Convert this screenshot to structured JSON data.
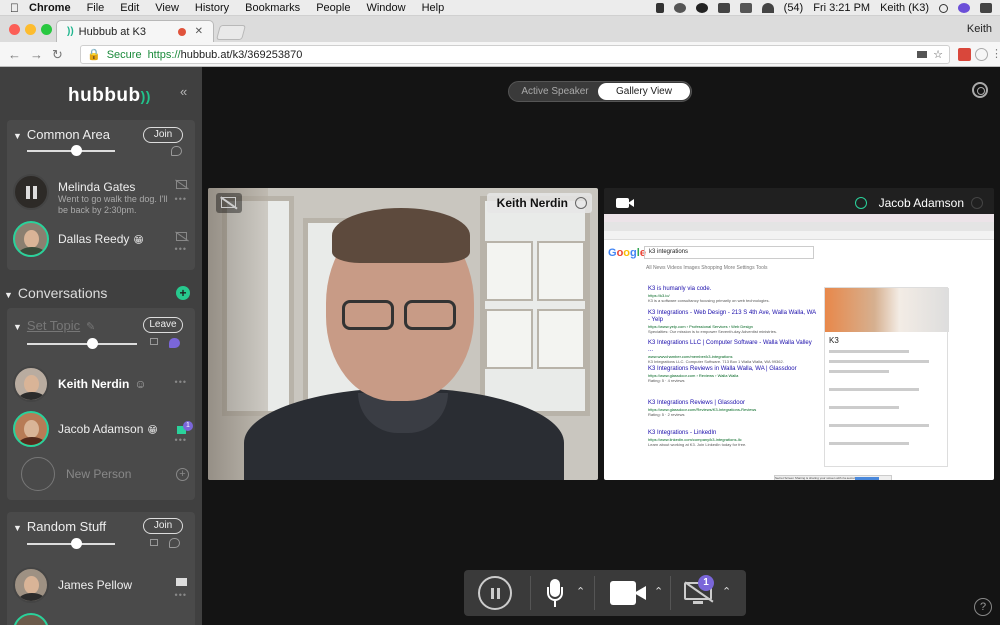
{
  "menubar": {
    "app": "Chrome",
    "items": [
      "File",
      "Edit",
      "View",
      "History",
      "Bookmarks",
      "People",
      "Window",
      "Help"
    ],
    "battery": "(54)",
    "clock": "Fri 3:21 PM",
    "user": "Keith (K3)"
  },
  "browser": {
    "tab_title": "Hubbub at K3",
    "profile_name": "Keith",
    "secure_label": "Secure",
    "url_scheme": "https://",
    "url_rest": "hubbub.at/k3/369253870"
  },
  "sidebar": {
    "brand": "hubbub",
    "common_area": {
      "title": "Common Area",
      "join_label": "Join",
      "members": [
        {
          "name": "Melinda Gates",
          "status": "Went to go walk the dog. I'll be back by 2:30pm."
        },
        {
          "name": "Dallas Reedy",
          "emoji": "😁"
        }
      ]
    },
    "conversations_label": "Conversations",
    "conversation": {
      "topic_placeholder": "Set Topic",
      "leave_label": "Leave",
      "members": [
        {
          "name": "Keith Nerdin"
        },
        {
          "name": "Jacob Adamson",
          "emoji": "😁",
          "badge": "1"
        }
      ],
      "new_person_label": "New Person"
    },
    "random_stuff": {
      "title": "Random Stuff",
      "join_label": "Join",
      "members": [
        {
          "name": "James Pellow"
        }
      ]
    }
  },
  "main": {
    "view_toggle": {
      "active_speaker": "Active Speaker",
      "gallery_view": "Gallery View",
      "selected": "Gallery View"
    },
    "tiles": [
      {
        "name": "Keith Nerdin",
        "type": "webcam"
      },
      {
        "name": "Jacob Adamson",
        "type": "screen-share"
      }
    ],
    "screenshare": {
      "search_query": "k3 integrations",
      "google_letters": [
        "G",
        "o",
        "o",
        "g",
        "l",
        "e"
      ],
      "nav": "All   News   Videos   Images   Shopping   More        Settings   Tools",
      "results": [
        {
          "title": "K3 is humanly via code.",
          "url": "https://k3.io/",
          "desc": "K3 is a software consultancy focusing primarily on web technologies."
        },
        {
          "title": "K3 Integrations - Web Design - 213 S 4th Ave, Walla Walla, WA - Yelp",
          "url": "https://www.yelp.com › Professional Services › Web Design",
          "desc": "Specialties: Our mission is to empower Seventh-day Adventist ministries."
        },
        {
          "title": "K3 Integrations LLC | Computer Software - Walla Walla Valley ...",
          "url": "www.wwvchamber.com/member/k3-integrations",
          "desc": "K3 Integrations LLC. Computer Software. 713 Box 1 Walla Walla, WA 99362."
        },
        {
          "title": "K3 Integrations Reviews in Walla Walla, WA | Glassdoor",
          "url": "https://www.glassdoor.com › Reviews › Walla Walla",
          "desc": "Rating: 5 · 4 reviews"
        },
        {
          "title": "K3 Integrations Reviews | Glassdoor",
          "url": "https://www.glassdoor.com/Reviews/K3-Integrations-Reviews",
          "desc": "Rating: 5 · 2 reviews"
        },
        {
          "title": "K3 Integrations - LinkedIn",
          "url": "https://www.linkedin.com/company/k3-integrations-llc",
          "desc": "Learn about working at K3. Join LinkedIn today for free."
        }
      ],
      "knowledge_title": "K3",
      "share_notice": "Secret Screen Sharing is sharing your screen with rta.secret.staging.K3.io"
    },
    "controls": {
      "screen_badge": "1"
    },
    "help_label": "?"
  },
  "colors": {
    "accent": "#27c98e",
    "badge": "#7a66d9"
  }
}
